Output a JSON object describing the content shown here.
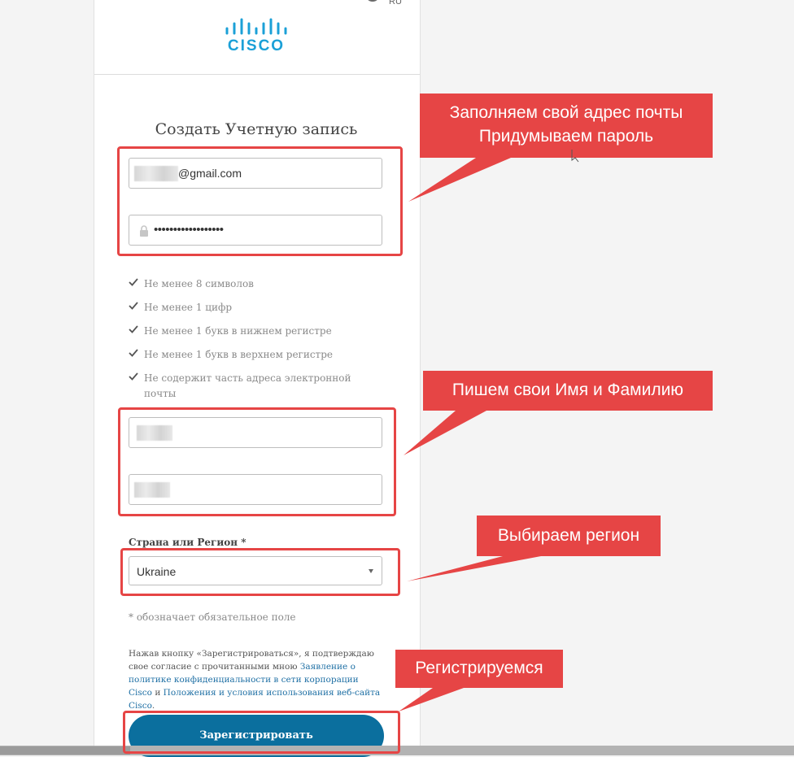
{
  "header": {
    "language": "RU",
    "logo_text": "CISCO"
  },
  "form": {
    "title": "Создать Учетную запись",
    "email": {
      "value_visible": "@gmail.com"
    },
    "password": {
      "masked_value": "••••••••••••••••••"
    },
    "password_requirements": [
      "Не менее 8 символов",
      "Не менее 1 цифр",
      "Не менее 1 букв в нижнем регистре",
      "Не менее 1 букв в верхнем регистре",
      "Не содержит часть адреса электронной почты"
    ],
    "country_label": "Страна или Регион *",
    "country_value": "Ukraine",
    "required_note": "* обозначает обязательное поле",
    "consent": {
      "text_1": "Нажав кнопку «Зарегистрироваться», я подтверждаю свое согласие с прочитанными мною",
      "link_1": "Заявление о политике конфиденциальности в сети корпорации Cisco",
      "text_2": "и",
      "link_2": "Положения и условия использования веб-сайта Cisco",
      "text_3": "."
    },
    "submit_label": "Зарегистрировать"
  },
  "annotations": {
    "email_password": {
      "line1": "Заполняем свой адрес почты",
      "line2": "Придумываем пароль"
    },
    "name": "Пишем свои Имя и Фамилию",
    "region": "Выбираем регион",
    "register": "Регистрируемся"
  },
  "colors": {
    "brand": "#1ba0d7",
    "button": "#0b6f9e",
    "annotation": "#e64545",
    "link": "#1e6fa4"
  }
}
